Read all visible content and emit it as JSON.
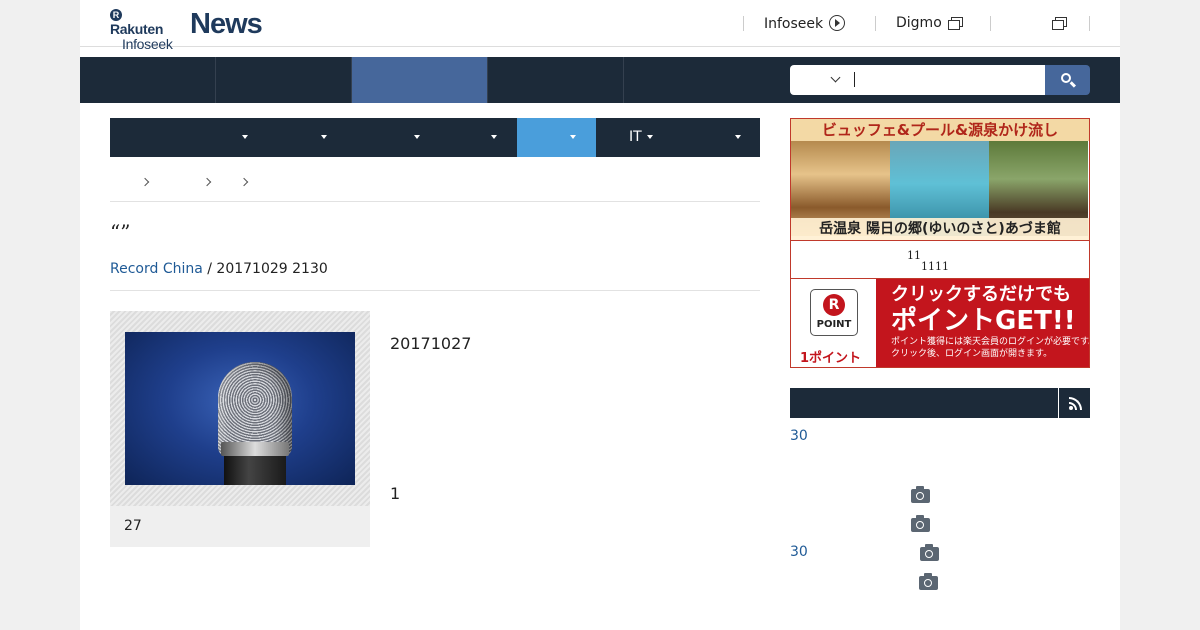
{
  "header": {
    "logo": {
      "rakuten": "Rakuten",
      "infoseek": "Infoseek",
      "news": "News"
    },
    "links": [
      {
        "label": "Infoseek",
        "icon": "circle-arrow-icon"
      },
      {
        "label": "Digmo",
        "icon": "external-window-icon"
      },
      {
        "label": "",
        "icon": "external-window-icon"
      }
    ]
  },
  "main_nav": {
    "active_index": 2,
    "search": {
      "value": "",
      "icon": "search-icon"
    },
    "colors": {
      "bg": "#1c2a39",
      "active": "#46679b"
    }
  },
  "sub_nav": {
    "items": [
      {
        "label": ""
      },
      {
        "label": ""
      },
      {
        "label": ""
      },
      {
        "label": ""
      },
      {
        "label": ""
      },
      {
        "label": "IT"
      },
      {
        "label": ""
      }
    ],
    "active_index": 4,
    "active_color": "#4a9edb"
  },
  "article": {
    "title": "“”",
    "source": "Record China",
    "date": "/ 20171029 2130",
    "figure_caption": "27",
    "paragraphs": [
      "20171027",
      "1"
    ]
  },
  "sidebar": {
    "ad1": {
      "headline": "ビュッフェ&プール&源泉かけ流し",
      "caption": "岳温泉 陽日の郷(ゆいのさと)あづま館",
      "dates_line1": "11",
      "dates_line2": "1111"
    },
    "point_ad": {
      "badge_letter": "R",
      "badge_label": "POINT",
      "reward": "1ポイント",
      "line1": "クリックするだけでも",
      "line2": "ポイントGET!!",
      "note1": "ポイント獲得には楽天会員のログインが必要です。",
      "note2": "クリック後、ログイン画面が開きます。"
    },
    "ranking": {
      "rss_icon": "rss-icon",
      "rows": [
        {
          "num": "30"
        },
        {
          "num": ""
        },
        {
          "num": ""
        },
        {
          "num": "30"
        },
        {
          "num": ""
        }
      ]
    }
  }
}
